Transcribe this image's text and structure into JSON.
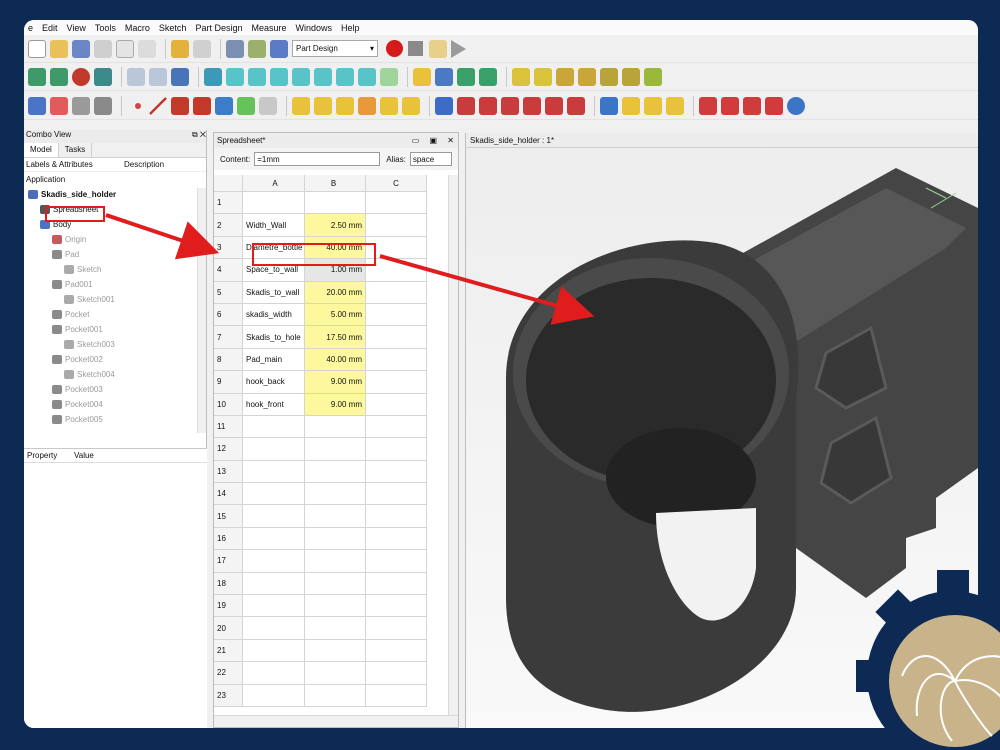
{
  "menu": [
    "e",
    "Edit",
    "View",
    "Tools",
    "Macro",
    "Sketch",
    "Part Design",
    "Measure",
    "Windows",
    "Help"
  ],
  "workbench": "Part Design",
  "combo": {
    "title": "Combo View",
    "tabs": [
      "Model",
      "Tasks"
    ],
    "col_labels": "Labels & Attributes",
    "col_desc": "Description",
    "application": "Application",
    "tree": [
      {
        "label": "Skadis_side_holder",
        "level": 0,
        "bold": true
      },
      {
        "label": "Spreadsheet",
        "level": 1
      },
      {
        "label": "Body",
        "level": 1
      },
      {
        "label": "Origin",
        "level": 2,
        "gray": true
      },
      {
        "label": "Pad",
        "level": 2,
        "gray": true
      },
      {
        "label": "Sketch",
        "level": 3,
        "gray": true
      },
      {
        "label": "Pad001",
        "level": 2,
        "gray": true
      },
      {
        "label": "Sketch001",
        "level": 3,
        "gray": true
      },
      {
        "label": "Pocket",
        "level": 2,
        "gray": true
      },
      {
        "label": "Pocket001",
        "level": 2,
        "gray": true
      },
      {
        "label": "Sketch003",
        "level": 3,
        "gray": true
      },
      {
        "label": "Pocket002",
        "level": 2,
        "gray": true
      },
      {
        "label": "Sketch004",
        "level": 3,
        "gray": true
      },
      {
        "label": "Pocket003",
        "level": 2,
        "gray": true
      },
      {
        "label": "Pocket004",
        "level": 2,
        "gray": true
      },
      {
        "label": "Pocket005",
        "level": 2,
        "gray": true
      }
    ],
    "prop_property": "Property",
    "prop_value": "Value"
  },
  "sheet": {
    "title": "Spreadsheet*",
    "content_label": "Content:",
    "content_value": "=1mm",
    "alias_label": "Alias:",
    "alias_value": "space",
    "columns": [
      "A",
      "B",
      "C"
    ],
    "rows": [
      {
        "n": "1",
        "a": "",
        "b": ""
      },
      {
        "n": "2",
        "a": "Width_Wall",
        "b": "2.50 mm"
      },
      {
        "n": "3",
        "a": "Diametre_bottle",
        "b": "40.00 mm"
      },
      {
        "n": "4",
        "a": "Space_to_wall",
        "b": "1.00 mm"
      },
      {
        "n": "5",
        "a": "Skadis_to_wall",
        "b": "20.00 mm"
      },
      {
        "n": "6",
        "a": "skadis_width",
        "b": "5.00 mm"
      },
      {
        "n": "7",
        "a": "Skadis_to_hole",
        "b": "17.50 mm"
      },
      {
        "n": "8",
        "a": "Pad_main",
        "b": "40.00 mm"
      },
      {
        "n": "9",
        "a": "hook_back",
        "b": "9.00 mm"
      },
      {
        "n": "10",
        "a": "hook_front",
        "b": "9.00 mm"
      },
      {
        "n": "11",
        "a": "",
        "b": ""
      },
      {
        "n": "12",
        "a": "",
        "b": ""
      },
      {
        "n": "13",
        "a": "",
        "b": ""
      },
      {
        "n": "14",
        "a": "",
        "b": ""
      },
      {
        "n": "15",
        "a": "",
        "b": ""
      },
      {
        "n": "16",
        "a": "",
        "b": ""
      },
      {
        "n": "17",
        "a": "",
        "b": ""
      },
      {
        "n": "18",
        "a": "",
        "b": ""
      },
      {
        "n": "19",
        "a": "",
        "b": ""
      },
      {
        "n": "20",
        "a": "",
        "b": ""
      },
      {
        "n": "21",
        "a": "",
        "b": ""
      },
      {
        "n": "22",
        "a": "",
        "b": ""
      },
      {
        "n": "23",
        "a": "",
        "b": ""
      }
    ]
  },
  "viewport": {
    "title": "Skadis_side_holder : 1*"
  },
  "colors": {
    "annotation": "#e01c1c",
    "cell_alias": "#fdf89e",
    "frame": "#0d2a54",
    "model": "#3d3d3d",
    "gear": "#0d2a54",
    "shell": "#c9b38a"
  }
}
